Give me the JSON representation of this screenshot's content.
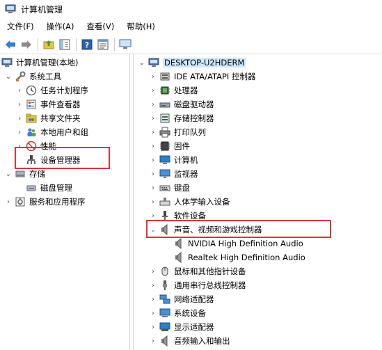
{
  "window": {
    "title": "计算机管理"
  },
  "menu": [
    "文件(F)",
    "操作(A)",
    "查看(V)",
    "帮助(H)"
  ],
  "toolbar": [
    "back-icon",
    "forward-icon",
    "up-folder-icon",
    "show-tree-icon",
    "help-icon",
    "properties-icon",
    "monitor-icon"
  ],
  "left_tree": {
    "root": "计算机管理(本地)",
    "items": [
      {
        "label": "系统工具",
        "level": 1,
        "expander": "expanded",
        "icon": "tools-icon"
      },
      {
        "label": "任务计划程序",
        "level": 2,
        "expander": "collapsed",
        "icon": "clock-icon"
      },
      {
        "label": "事件查看器",
        "level": 2,
        "expander": "collapsed",
        "icon": "event-viewer-icon"
      },
      {
        "label": "共享文件夹",
        "level": 2,
        "expander": "collapsed",
        "icon": "shared-folder-icon"
      },
      {
        "label": "本地用户和组",
        "level": 2,
        "expander": "collapsed",
        "icon": "users-icon"
      },
      {
        "label": "性能",
        "level": 2,
        "expander": "collapsed",
        "icon": "performance-icon"
      },
      {
        "label": "设备管理器",
        "level": 2,
        "expander": "none",
        "icon": "device-manager-icon",
        "selected": true
      },
      {
        "label": "存储",
        "level": 1,
        "expander": "expanded",
        "icon": "storage-icon"
      },
      {
        "label": "磁盘管理",
        "level": 2,
        "expander": "none",
        "icon": "disk-management-icon"
      },
      {
        "label": "服务和应用程序",
        "level": 1,
        "expander": "collapsed",
        "icon": "services-icon"
      }
    ]
  },
  "right_tree": {
    "root": "DESKTOP-U2HDERM",
    "categories": [
      {
        "label": "IDE ATA/ATAPI 控制器",
        "expander": "collapsed",
        "icon": "ide-icon"
      },
      {
        "label": "处理器",
        "expander": "collapsed",
        "icon": "processor-icon"
      },
      {
        "label": "磁盘驱动器",
        "expander": "collapsed",
        "icon": "disk-drive-icon"
      },
      {
        "label": "存储控制器",
        "expander": "collapsed",
        "icon": "storage-controller-icon"
      },
      {
        "label": "打印队列",
        "expander": "collapsed",
        "icon": "printer-icon"
      },
      {
        "label": "固件",
        "expander": "collapsed",
        "icon": "firmware-icon"
      },
      {
        "label": "计算机",
        "expander": "collapsed",
        "icon": "computer-icon"
      },
      {
        "label": "监视器",
        "expander": "collapsed",
        "icon": "monitor-icon"
      },
      {
        "label": "键盘",
        "expander": "collapsed",
        "icon": "keyboard-icon"
      },
      {
        "label": "人体学输入设备",
        "expander": "collapsed",
        "icon": "hid-icon"
      },
      {
        "label": "软件设备",
        "expander": "collapsed",
        "icon": "software-device-icon"
      },
      {
        "label": "声音、视频和游戏控制器",
        "expander": "expanded",
        "icon": "speaker-icon",
        "highlighted": true
      },
      {
        "label": "NVIDIA High Definition Audio",
        "expander": "none",
        "icon": "speaker-icon",
        "child": true
      },
      {
        "label": "Realtek High Definition Audio",
        "expander": "none",
        "icon": "speaker-icon",
        "child": true
      },
      {
        "label": "鼠标和其他指针设备",
        "expander": "collapsed",
        "icon": "mouse-icon"
      },
      {
        "label": "通用串行总线控制器",
        "expander": "collapsed",
        "icon": "usb-icon"
      },
      {
        "label": "网络适配器",
        "expander": "collapsed",
        "icon": "network-adapter-icon"
      },
      {
        "label": "系统设备",
        "expander": "collapsed",
        "icon": "system-device-icon"
      },
      {
        "label": "显示适配器",
        "expander": "collapsed",
        "icon": "display-adapter-icon"
      },
      {
        "label": "音频输入和输出",
        "expander": "collapsed",
        "icon": "audio-io-icon"
      }
    ]
  },
  "colors": {
    "highlight_border": "#d9343b",
    "selection": "#cce8ff",
    "root_selection": "#cce8ff"
  }
}
